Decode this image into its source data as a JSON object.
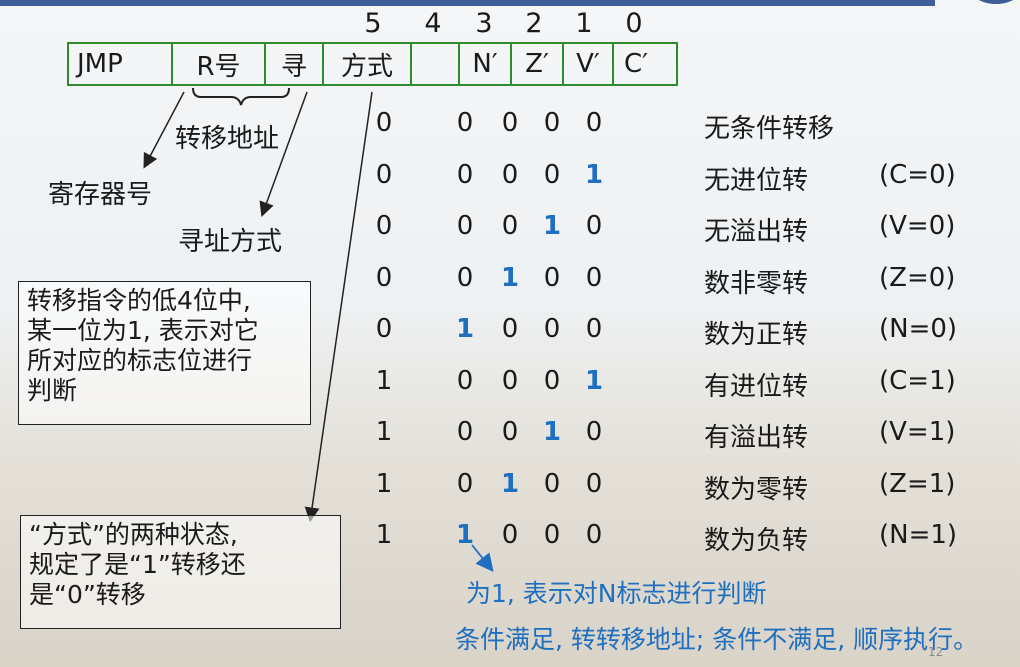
{
  "bit_positions": [
    "5",
    "4",
    "3",
    "2",
    "1",
    "0"
  ],
  "format": {
    "fields": [
      "JMP",
      "R号",
      "寻",
      "方式",
      "",
      "N′",
      "Z′",
      "V′",
      "C′"
    ]
  },
  "labels": {
    "transfer_address": "转移地址",
    "register_number": "寄存器号",
    "addressing_mode": "寻址方式"
  },
  "notes": {
    "box1": [
      "转移指令的低4位中,",
      "某一位为1, 表示对它",
      "所对应的标志位进行",
      "判断"
    ],
    "box2": [
      "“方式”的两种状态,",
      "规定了是“1”转移还",
      "是“0”转移"
    ]
  },
  "rows": [
    {
      "mode": "0",
      "bits": [
        "0",
        "0",
        "0",
        "0"
      ],
      "highlight": -1,
      "desc": "无条件转移",
      "cond": ""
    },
    {
      "mode": "0",
      "bits": [
        "0",
        "0",
        "0",
        "1"
      ],
      "highlight": 3,
      "desc": "无进位转",
      "cond": "(C=0)"
    },
    {
      "mode": "0",
      "bits": [
        "0",
        "0",
        "1",
        "0"
      ],
      "highlight": 2,
      "desc": "无溢出转",
      "cond": "(V=0)"
    },
    {
      "mode": "0",
      "bits": [
        "0",
        "1",
        "0",
        "0"
      ],
      "highlight": 1,
      "desc": "数非零转",
      "cond": "(Z=0)"
    },
    {
      "mode": "0",
      "bits": [
        "1",
        "0",
        "0",
        "0"
      ],
      "highlight": 0,
      "desc": "数为正转",
      "cond": "(N=0)"
    },
    {
      "mode": "1",
      "bits": [
        "0",
        "0",
        "0",
        "1"
      ],
      "highlight": 3,
      "desc": "有进位转",
      "cond": "(C=1)"
    },
    {
      "mode": "1",
      "bits": [
        "0",
        "0",
        "1",
        "0"
      ],
      "highlight": 2,
      "desc": "有溢出转",
      "cond": "(V=1)"
    },
    {
      "mode": "1",
      "bits": [
        "0",
        "1",
        "0",
        "0"
      ],
      "highlight": 1,
      "desc": "数为零转",
      "cond": "(Z=1)"
    },
    {
      "mode": "1",
      "bits": [
        "1",
        "0",
        "0",
        "0"
      ],
      "highlight": 0,
      "desc": "数为负转",
      "cond": "(N=1)"
    }
  ],
  "bottom_notes": {
    "line1": "为1, 表示对N标志进行判断",
    "line2": "条件满足, 转转移地址; 条件不满足, 顺序执行。"
  },
  "page_number": "12",
  "colors": {
    "accent": "#1f6fc0",
    "border_green": "#2e8b2e",
    "bar": "#3f5f9a"
  }
}
